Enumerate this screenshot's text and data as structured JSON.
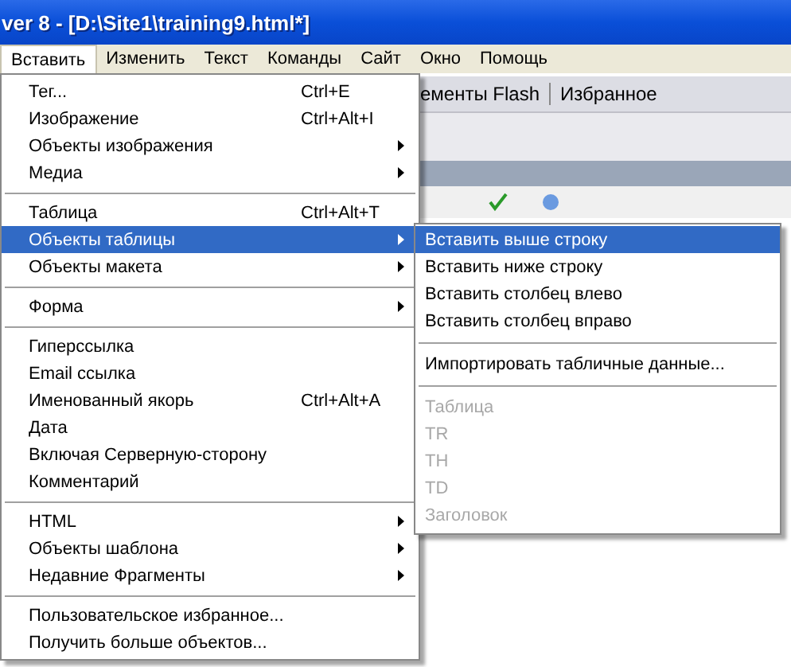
{
  "window": {
    "title": "ver 8 - [D:\\Site1\\training9.html*]"
  },
  "menubar": [
    {
      "label": "Вставить",
      "selected": true
    },
    {
      "label": "Изменить",
      "selected": false
    },
    {
      "label": "Текст",
      "selected": false
    },
    {
      "label": "Команды",
      "selected": false
    },
    {
      "label": "Сайт",
      "selected": false
    },
    {
      "label": "Окно",
      "selected": false
    },
    {
      "label": "Помощь",
      "selected": false
    }
  ],
  "insert_bar_tabs": [
    "ементы Flash",
    "Избранное"
  ],
  "menu": [
    {
      "kind": "item",
      "label": "Тег...",
      "shortcut": "Ctrl+E",
      "submenu": false,
      "selected": false
    },
    {
      "kind": "item",
      "label": "Изображение",
      "shortcut": "Ctrl+Alt+I",
      "submenu": false,
      "selected": false
    },
    {
      "kind": "item",
      "label": "Объекты изображения",
      "submenu": true,
      "selected": false
    },
    {
      "kind": "item",
      "label": "Медиа",
      "submenu": true,
      "selected": false
    },
    {
      "kind": "separator"
    },
    {
      "kind": "item",
      "label": "Таблица",
      "shortcut": "Ctrl+Alt+T",
      "submenu": false,
      "selected": false
    },
    {
      "kind": "item",
      "label": "Объекты таблицы",
      "submenu": true,
      "selected": true
    },
    {
      "kind": "item",
      "label": "Объекты макета",
      "submenu": true,
      "selected": false
    },
    {
      "kind": "separator"
    },
    {
      "kind": "item",
      "label": "Форма",
      "submenu": true,
      "selected": false
    },
    {
      "kind": "separator"
    },
    {
      "kind": "item",
      "label": "Гиперссылка",
      "submenu": false,
      "selected": false
    },
    {
      "kind": "item",
      "label": "Email ссылка",
      "submenu": false,
      "selected": false
    },
    {
      "kind": "item",
      "label": "Именованный якорь",
      "shortcut": "Ctrl+Alt+A",
      "submenu": false,
      "selected": false
    },
    {
      "kind": "item",
      "label": "Дата",
      "submenu": false,
      "selected": false
    },
    {
      "kind": "item",
      "label": "Включая Серверную-сторону",
      "submenu": false,
      "selected": false
    },
    {
      "kind": "item",
      "label": "Комментарий",
      "submenu": false,
      "selected": false
    },
    {
      "kind": "separator"
    },
    {
      "kind": "item",
      "label": "HTML",
      "submenu": true,
      "selected": false
    },
    {
      "kind": "item",
      "label": "Объекты шаблона",
      "submenu": true,
      "selected": false
    },
    {
      "kind": "item",
      "label": "Недавние Фрагменты",
      "submenu": true,
      "selected": false
    },
    {
      "kind": "separator"
    },
    {
      "kind": "item",
      "label": "Пользовательское избранное...",
      "submenu": false,
      "selected": false
    },
    {
      "kind": "item",
      "label": "Получить больше объектов...",
      "submenu": false,
      "selected": false
    }
  ],
  "submenu": [
    {
      "kind": "item",
      "label": "Вставить выше строку",
      "selected": true,
      "disabled": false
    },
    {
      "kind": "item",
      "label": "Вставить ниже строку",
      "selected": false,
      "disabled": false
    },
    {
      "kind": "item",
      "label": "Вставить столбец влево",
      "selected": false,
      "disabled": false
    },
    {
      "kind": "item",
      "label": "Вставить столбец вправо",
      "selected": false,
      "disabled": false
    },
    {
      "kind": "separator"
    },
    {
      "kind": "item",
      "label": "Импортировать табличные данные...",
      "selected": false,
      "disabled": false
    },
    {
      "kind": "separator"
    },
    {
      "kind": "item",
      "label": "Таблица",
      "selected": false,
      "disabled": true
    },
    {
      "kind": "item",
      "label": "TR",
      "selected": false,
      "disabled": true
    },
    {
      "kind": "item",
      "label": "TH",
      "selected": false,
      "disabled": true
    },
    {
      "kind": "item",
      "label": "TD",
      "selected": false,
      "disabled": true
    },
    {
      "kind": "item",
      "label": "Заголовок",
      "selected": false,
      "disabled": true
    }
  ]
}
